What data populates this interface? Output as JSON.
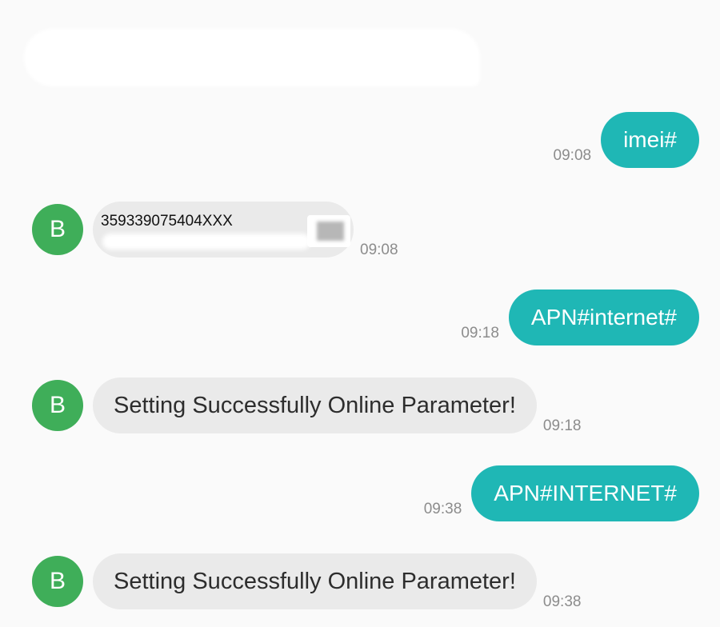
{
  "colors": {
    "outgoing_bubble": "#1fb7b5",
    "incoming_bubble": "#eaeaea",
    "avatar": "#3fae59",
    "timestamp": "#8c8c8c",
    "background": "#fafafa"
  },
  "contact": {
    "avatar_initial": "B"
  },
  "messages": [
    {
      "direction": "out",
      "text": "imei#",
      "time": "09:08"
    },
    {
      "direction": "in",
      "text": "359339075404XXX",
      "time": "09:08"
    },
    {
      "direction": "out",
      "text": "APN#internet#",
      "time": "09:18"
    },
    {
      "direction": "in",
      "text": "Setting Successfully Online Parameter!",
      "time": "09:18"
    },
    {
      "direction": "out",
      "text": "APN#INTERNET#",
      "time": "09:38"
    },
    {
      "direction": "in",
      "text": "Setting Successfully Online Parameter!",
      "time": "09:38"
    }
  ]
}
